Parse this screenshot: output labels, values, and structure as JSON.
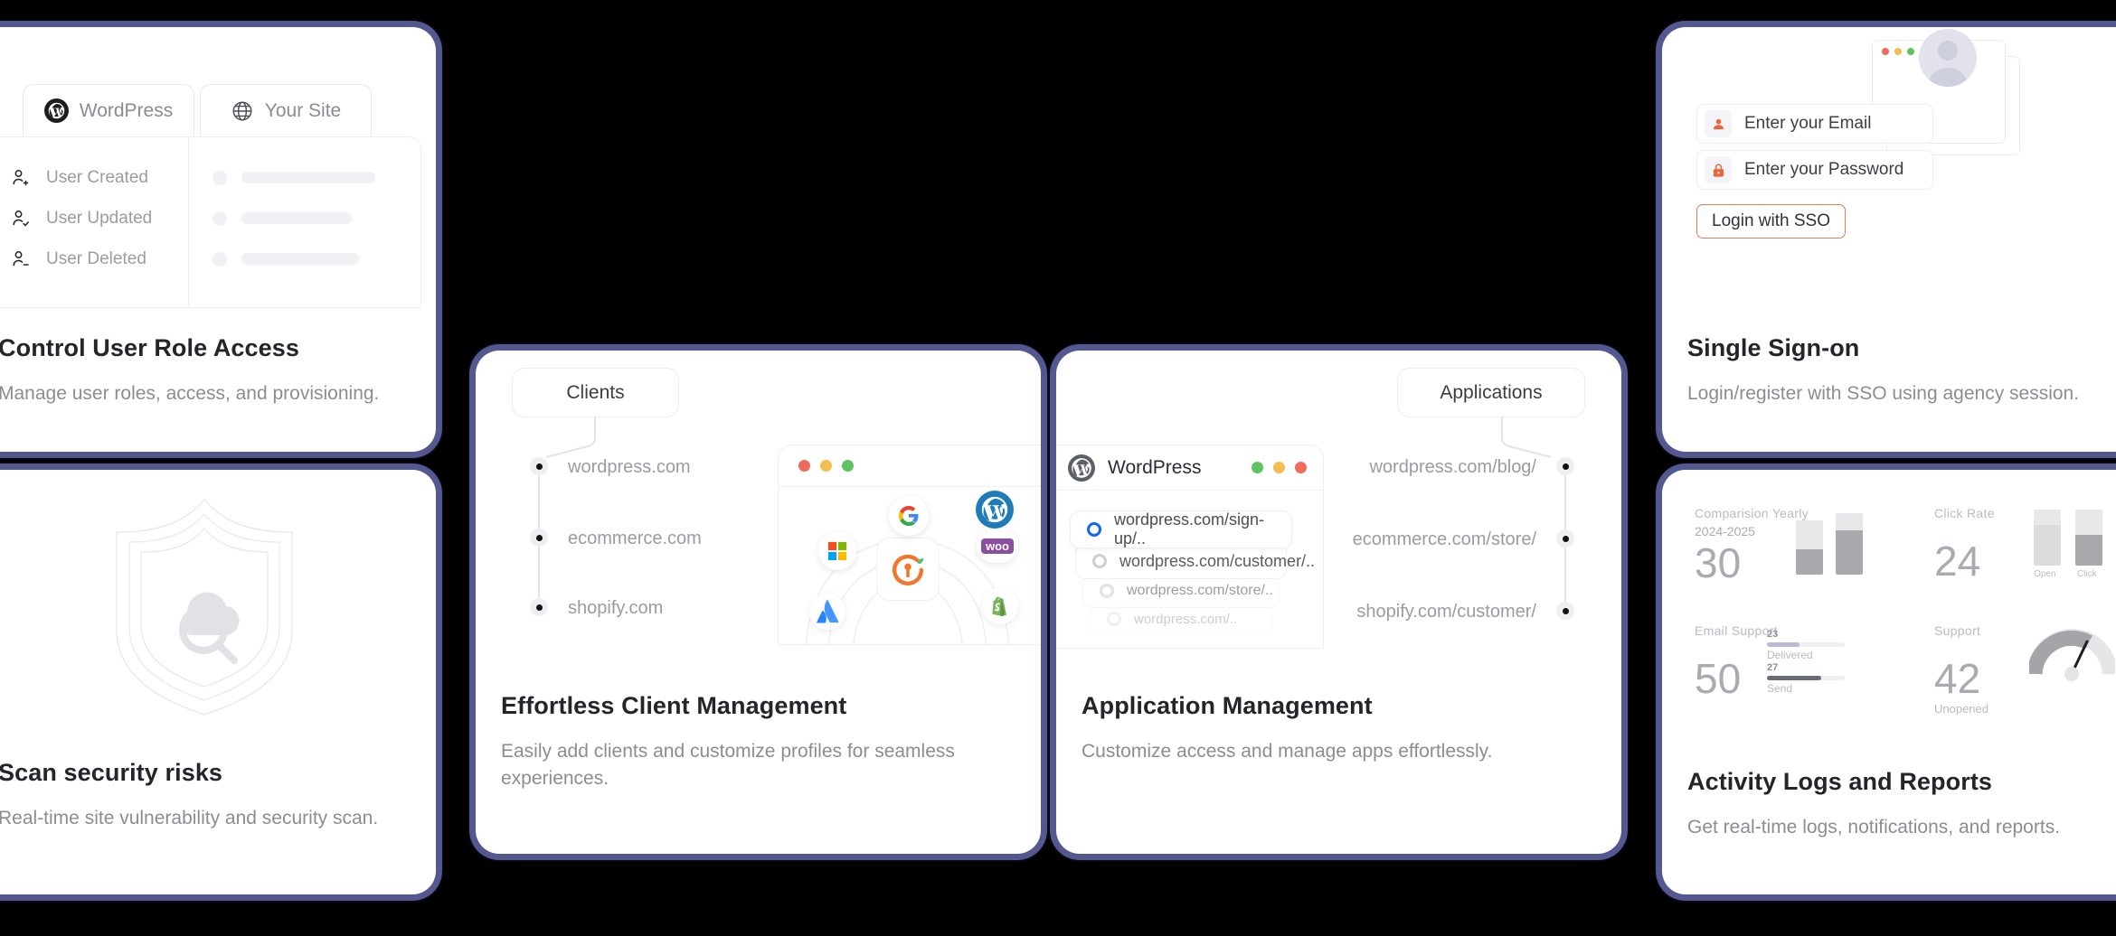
{
  "cards": {
    "roles": {
      "title": "Control User Role Access",
      "desc": "Manage user roles, access, and provisioning.",
      "tabs": [
        {
          "label": "WordPress",
          "icon": "wordpress-icon"
        },
        {
          "label": "Your Site",
          "icon": "globe-icon"
        }
      ],
      "events": [
        {
          "label": "User Created",
          "icon": "user-plus-icon"
        },
        {
          "label": "User Updated",
          "icon": "user-check-icon"
        },
        {
          "label": "User Deleted",
          "icon": "user-minus-icon"
        }
      ]
    },
    "scan": {
      "title": "Scan security risks",
      "desc": "Real-time site vulnerability and security scan.",
      "art": "shield-cloud-magnifier-icon"
    },
    "clients": {
      "title": "Effortless Client Management",
      "desc": "Easily add clients and customize profiles for seamless experiences.",
      "chip": "Clients",
      "timeline": [
        "wordpress.com",
        "ecommerce.com",
        "shopify.com"
      ],
      "browser": {
        "traffic_lights": [
          "#ef6b5c",
          "#f3bd4f",
          "#5dc45f"
        ],
        "hub_icon": "sso-key-icon",
        "integrations": [
          "google-icon",
          "wordpress-icon",
          "microsoft-icon",
          "woocommerce-icon",
          "atlassian-icon",
          "shopify-icon"
        ]
      }
    },
    "apps": {
      "title": "Application Management",
      "desc": "Customize access and manage apps effortlessly.",
      "chip": "Applications",
      "window": {
        "name": "WordPress",
        "icon": "wordpress-icon",
        "traffic_lights": [
          "#5dc45f",
          "#f3bd4f",
          "#ef6b5c"
        ],
        "urls": [
          {
            "label": "wordpress.com/sign-up/..",
            "selected": true
          },
          {
            "label": "wordpress.com/customer/..",
            "selected": false
          },
          {
            "label": "wordpress.com/store/..",
            "selected": false
          },
          {
            "label": "wordpress.com/..",
            "selected": false
          }
        ]
      },
      "timeline": [
        "wordpress.com/blog/",
        "ecommerce.com/store/",
        "shopify.com/customer/"
      ]
    },
    "sso": {
      "title": "Single Sign-on",
      "desc": "Login/register with SSO using agency session.",
      "email_placeholder": "Enter your Email",
      "password_placeholder": "Enter your Password",
      "button_label": "Login with SSO",
      "button_border_color": "#e07b52",
      "email_icon": "user-icon",
      "password_icon": "lock-icon",
      "avatar_icon": "avatar-icon",
      "traffic_lights": [
        "#ef6b5c",
        "#f3bd4f",
        "#5dc45f"
      ]
    },
    "logs": {
      "title": "Activity Logs and Reports",
      "desc": "Get real-time logs, notifications, and reports.",
      "widgets": [
        {
          "title": "Comparision Yearly",
          "subtitle": "2024-2025",
          "value": "30",
          "type": "bars",
          "bars": [
            {
              "fill_pct": 46
            },
            {
              "fill_pct": 72
            }
          ]
        },
        {
          "title": "Click Rate",
          "value": "24",
          "type": "bars",
          "bars": [
            {
              "fill_pct": 72,
              "label": "Open"
            },
            {
              "fill_pct": 55,
              "label": "Click"
            }
          ]
        },
        {
          "title": "Email Support",
          "value": "50",
          "type": "progress",
          "rows": [
            {
              "num": "23",
              "label": "Delivered",
              "pct": 42,
              "color": "#b9bbd6"
            },
            {
              "num": "27",
              "label": "Send",
              "pct": 70,
              "color": "#6b6d74"
            }
          ]
        },
        {
          "title": "Support",
          "value": "42",
          "note": "Unopened",
          "type": "gauge",
          "gauge_pct": 58
        }
      ]
    }
  }
}
